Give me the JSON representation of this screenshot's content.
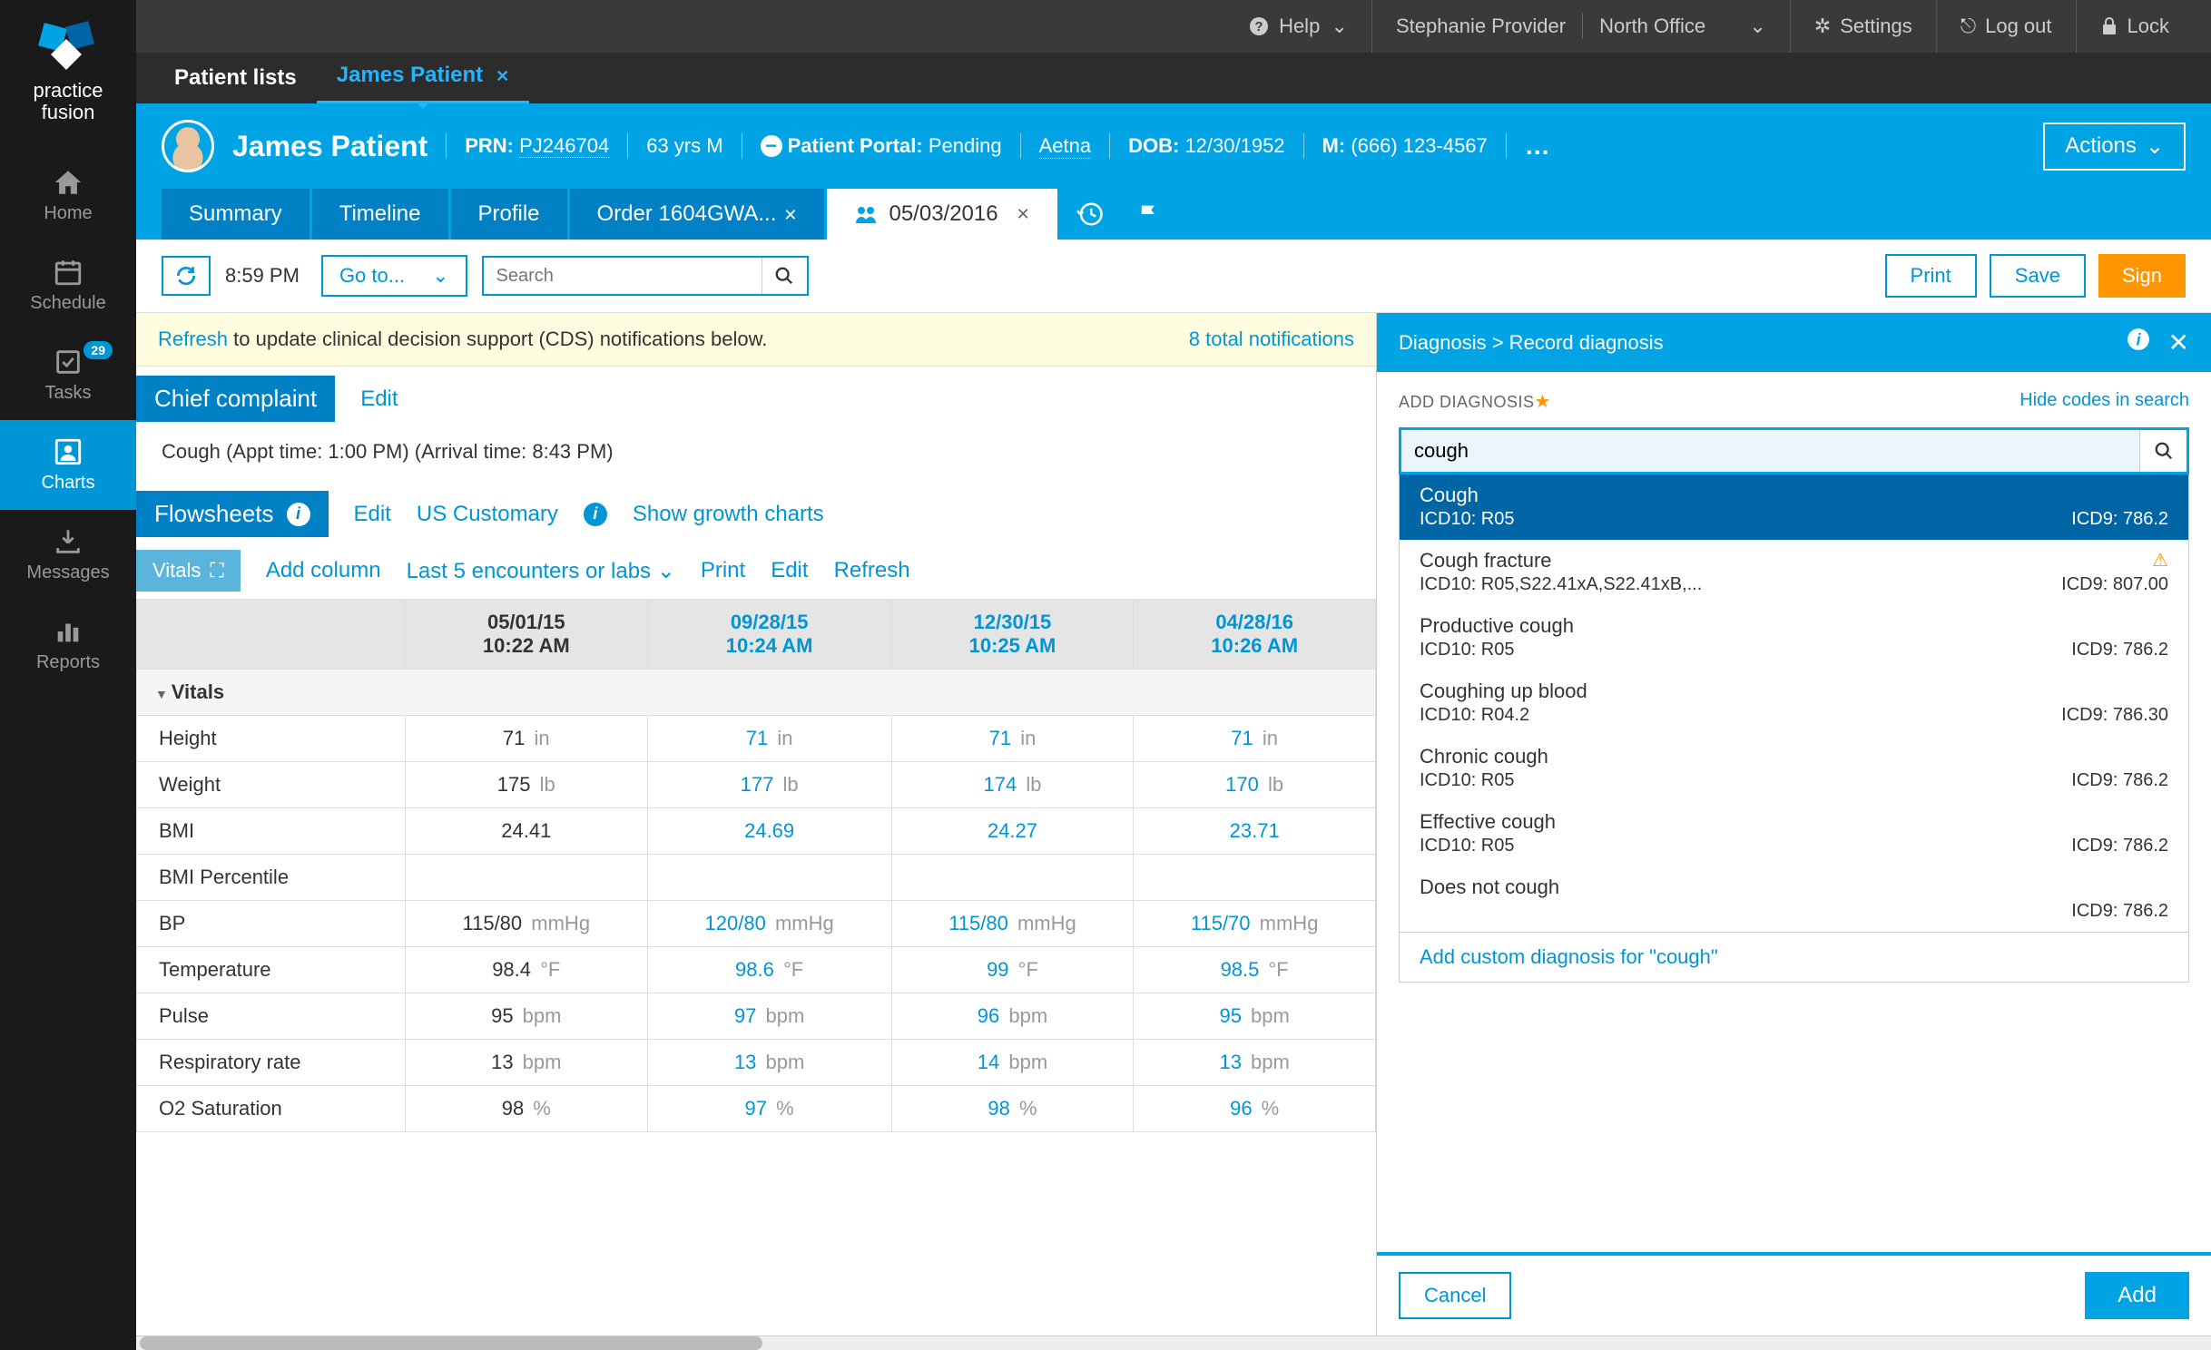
{
  "brand": {
    "line1": "practice",
    "line2": "fusion"
  },
  "nav": {
    "home": "Home",
    "schedule": "Schedule",
    "tasks": "Tasks",
    "tasks_badge": "29",
    "charts": "Charts",
    "messages": "Messages",
    "reports": "Reports"
  },
  "topbar": {
    "help": "Help",
    "provider": "Stephanie Provider",
    "location": "North Office",
    "settings": "Settings",
    "logout": "Log out",
    "lock": "Lock"
  },
  "top_tabs": {
    "patient_lists": "Patient lists",
    "patient_tab": "James Patient"
  },
  "patient": {
    "name": "James Patient",
    "prn_label": "PRN:",
    "prn": "PJ246704",
    "age_sex": "63 yrs M",
    "portal_label": "Patient Portal:",
    "portal_status": "Pending",
    "insurance": "Aetna",
    "dob_label": "DOB:",
    "dob": "12/30/1952",
    "phone_label": "M:",
    "phone": "(666) 123-4567",
    "actions": "Actions"
  },
  "subtabs": {
    "summary": "Summary",
    "timeline": "Timeline",
    "profile": "Profile",
    "order": "Order 1604GWA...",
    "encounter": "05/03/2016"
  },
  "toolbar": {
    "time": "8:59 PM",
    "goto": "Go to...",
    "search_placeholder": "Search",
    "print": "Print",
    "save": "Save",
    "sign": "Sign"
  },
  "notice": {
    "refresh": "Refresh",
    "text": " to update clinical decision support (CDS) notifications below.",
    "count": "8 total notifications"
  },
  "chief": {
    "title": "Chief complaint",
    "edit": "Edit",
    "text": "Cough  (Appt time: 1:00 PM) (Arrival time: 8:43 PM)"
  },
  "flowsheets": {
    "title": "Flowsheets",
    "edit": "Edit",
    "us": "US Customary",
    "growth": "Show growth charts"
  },
  "vitals": {
    "tab": "Vitals",
    "add_column": "Add column",
    "last5": "Last 5 encounters or labs",
    "print": "Print",
    "edit": "Edit",
    "refresh": "Refresh",
    "group": "Vitals",
    "columns": [
      {
        "date": "05/01/15",
        "time": "10:22 AM",
        "link": false
      },
      {
        "date": "09/28/15",
        "time": "10:24 AM",
        "link": true
      },
      {
        "date": "12/30/15",
        "time": "10:25 AM",
        "link": true
      },
      {
        "date": "04/28/16",
        "time": "10:26 AM",
        "link": true
      }
    ],
    "rows": [
      {
        "label": "Height",
        "vals": [
          {
            "v": "71",
            "u": "in"
          },
          {
            "v": "71",
            "u": "in"
          },
          {
            "v": "71",
            "u": "in"
          },
          {
            "v": "71",
            "u": "in"
          }
        ]
      },
      {
        "label": "Weight",
        "vals": [
          {
            "v": "175",
            "u": "lb"
          },
          {
            "v": "177",
            "u": "lb"
          },
          {
            "v": "174",
            "u": "lb"
          },
          {
            "v": "170",
            "u": "lb"
          }
        ]
      },
      {
        "label": "BMI",
        "vals": [
          {
            "v": "24.41",
            "u": ""
          },
          {
            "v": "24.69",
            "u": ""
          },
          {
            "v": "24.27",
            "u": ""
          },
          {
            "v": "23.71",
            "u": ""
          }
        ]
      },
      {
        "label": "BMI Percentile",
        "vals": [
          {
            "v": "",
            "u": ""
          },
          {
            "v": "",
            "u": ""
          },
          {
            "v": "",
            "u": ""
          },
          {
            "v": "",
            "u": ""
          }
        ]
      },
      {
        "label": "BP",
        "vals": [
          {
            "v": "115/80",
            "u": "mmHg"
          },
          {
            "v": "120/80",
            "u": "mmHg"
          },
          {
            "v": "115/80",
            "u": "mmHg"
          },
          {
            "v": "115/70",
            "u": "mmHg"
          }
        ]
      },
      {
        "label": "Temperature",
        "vals": [
          {
            "v": "98.4",
            "u": "°F"
          },
          {
            "v": "98.6",
            "u": "°F"
          },
          {
            "v": "99",
            "u": "°F"
          },
          {
            "v": "98.5",
            "u": "°F"
          }
        ]
      },
      {
        "label": "Pulse",
        "vals": [
          {
            "v": "95",
            "u": "bpm"
          },
          {
            "v": "97",
            "u": "bpm"
          },
          {
            "v": "96",
            "u": "bpm"
          },
          {
            "v": "95",
            "u": "bpm"
          }
        ]
      },
      {
        "label": "Respiratory rate",
        "vals": [
          {
            "v": "13",
            "u": "bpm"
          },
          {
            "v": "13",
            "u": "bpm"
          },
          {
            "v": "14",
            "u": "bpm"
          },
          {
            "v": "13",
            "u": "bpm"
          }
        ]
      },
      {
        "label": "O2 Saturation",
        "vals": [
          {
            "v": "98",
            "u": "%"
          },
          {
            "v": "97",
            "u": "%"
          },
          {
            "v": "98",
            "u": "%"
          },
          {
            "v": "96",
            "u": "%"
          }
        ]
      }
    ]
  },
  "panel": {
    "breadcrumb": "Diagnosis > Record diagnosis",
    "add_label": "ADD DIAGNOSIS",
    "hide_codes": "Hide codes in search",
    "search_value": "cough",
    "results": [
      {
        "name": "Cough",
        "icd10": "ICD10: R05",
        "icd9": "ICD9: 786.2",
        "selected": true,
        "warn": false
      },
      {
        "name": "Cough fracture",
        "icd10": "ICD10: R05,S22.41xA,S22.41xB,...",
        "icd9": "ICD9: 807.00",
        "selected": false,
        "warn": true
      },
      {
        "name": "Productive cough",
        "icd10": "ICD10: R05",
        "icd9": "ICD9: 786.2",
        "selected": false,
        "warn": false
      },
      {
        "name": "Coughing up blood",
        "icd10": "ICD10: R04.2",
        "icd9": "ICD9: 786.30",
        "selected": false,
        "warn": false
      },
      {
        "name": "Chronic cough",
        "icd10": "ICD10: R05",
        "icd9": "ICD9: 786.2",
        "selected": false,
        "warn": false
      },
      {
        "name": "Effective cough",
        "icd10": "ICD10: R05",
        "icd9": "ICD9: 786.2",
        "selected": false,
        "warn": false
      },
      {
        "name": "Does not cough",
        "icd10": "",
        "icd9": "ICD9: 786.2",
        "selected": false,
        "warn": false
      }
    ],
    "add_custom": "Add custom diagnosis for \"cough\"",
    "cancel": "Cancel",
    "add": "Add"
  }
}
